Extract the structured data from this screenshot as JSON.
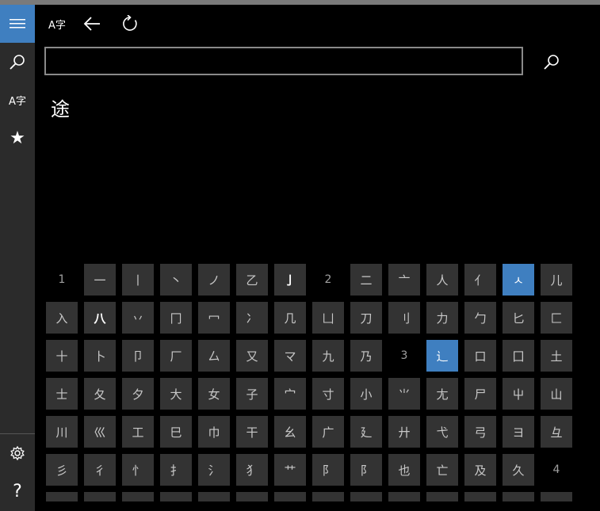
{
  "rail": {
    "items": [
      {
        "name": "hamburger-menu-icon"
      },
      {
        "name": "search-icon"
      },
      {
        "name": "character-lookup-icon",
        "label": "A字"
      },
      {
        "name": "favorites-star-icon",
        "glyph": "★"
      },
      {
        "name": "settings-gear-icon"
      },
      {
        "name": "help-icon",
        "glyph": "?"
      }
    ]
  },
  "toolbar": {
    "lookup_label": "A字",
    "back_icon": "arrow-left-icon",
    "refresh_icon": "refresh-icon"
  },
  "search": {
    "value": "",
    "placeholder": ""
  },
  "result": {
    "character": "途"
  },
  "colors": {
    "accent": "#3f7fc0",
    "tile": "#333333",
    "rail": "#2b2b2b"
  },
  "radicals": {
    "selected": [
      "ㅅ",
      "辶"
    ],
    "rows": [
      [
        "1",
        "一",
        "丨",
        "丶",
        "ノ",
        "乙",
        "亅",
        "2",
        "二",
        "亠",
        "人",
        "亻",
        "ㅅ",
        "儿"
      ],
      [
        "入",
        "八",
        "丷",
        "冂",
        "冖",
        "冫",
        "几",
        "凵",
        "刀",
        "刂",
        "力",
        "勹",
        "匕",
        "匚"
      ],
      [
        "十",
        "卜",
        "卩",
        "厂",
        "厶",
        "又",
        "マ",
        "九",
        "乃",
        "3",
        "辶",
        "口",
        "囗",
        "土"
      ],
      [
        "士",
        "夂",
        "夕",
        "大",
        "女",
        "子",
        "宀",
        "寸",
        "小",
        "⺌",
        "尢",
        "尸",
        "屮",
        "山"
      ],
      [
        "川",
        "巛",
        "工",
        "巳",
        "巾",
        "干",
        "幺",
        "广",
        "廴",
        "廾",
        "弋",
        "弓",
        "ヨ",
        "彑"
      ],
      [
        "彡",
        "彳",
        "忄",
        "扌",
        "氵",
        "犭",
        "艹",
        "阝",
        "阝",
        "也",
        "亡",
        "及",
        "久",
        "4"
      ],
      [
        "",
        "",
        "",
        "",
        "",
        "",
        "",
        "",
        "",
        "",
        "",
        "",
        "",
        ""
      ]
    ],
    "bright": [
      "亅",
      "八"
    ]
  }
}
